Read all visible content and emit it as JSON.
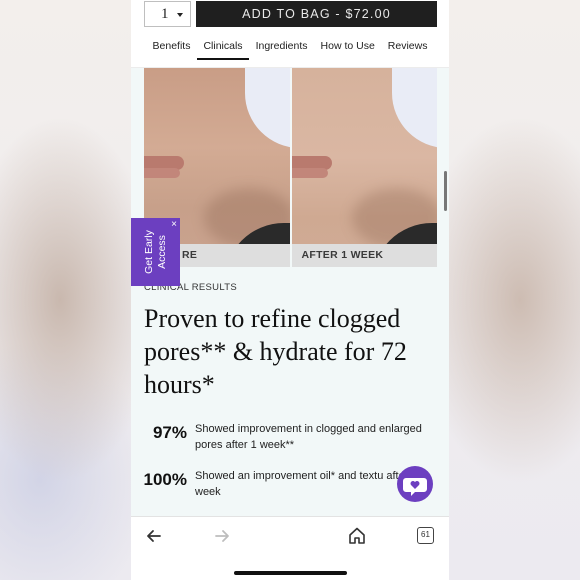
{
  "topbar": {
    "quantity": "1",
    "add_to_bag": "ADD TO BAG - $72.00"
  },
  "tabs": [
    {
      "label": "Benefits"
    },
    {
      "label": "Clinicals"
    },
    {
      "label": "Ingredients"
    },
    {
      "label": "How to Use"
    },
    {
      "label": "Reviews"
    }
  ],
  "active_tab": "Clinicals",
  "photos": {
    "before_label": "RE",
    "after_label": "AFTER 1 WEEK"
  },
  "early_access": {
    "label": "Get Early Access",
    "close": "×"
  },
  "clinical": {
    "kicker": "CLINICAL RESULTS",
    "headline": "Proven to refine clogged pores** & hydrate for 72 hours*",
    "stats": [
      {
        "value": "97%",
        "text": "Showed improvement in clogged and enlarged pores after 1 week**"
      },
      {
        "value": "100%",
        "text": "Showed an improvement oil* and textu after 1 week"
      }
    ]
  },
  "browser": {
    "tab_count": "61"
  },
  "colors": {
    "accent": "#6c3fc0",
    "button_dark": "#1f1f1f",
    "content_bg": "#f2f8f8"
  },
  "icons": {
    "back": "back-arrow-icon",
    "forward": "forward-arrow-icon",
    "home": "home-icon",
    "tabs": "tabs-icon",
    "chat": "chat-heart-icon"
  }
}
